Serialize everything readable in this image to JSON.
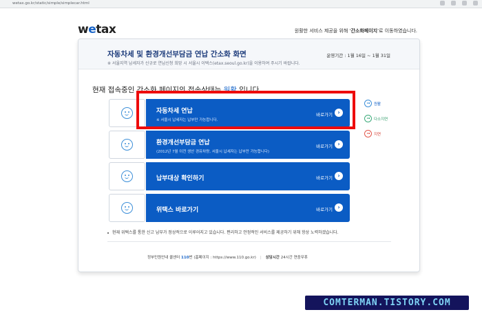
{
  "browser": {
    "url": "wetax.go.kr/static/simple/simplecar.html"
  },
  "header": {
    "logo_pre": "w",
    "logo_e": "e",
    "logo_post": "tax",
    "notice_pre": "원활한 서비스 제공을 위해 '",
    "notice_bold": "간소화페이지",
    "notice_post": "'로 이동하였습니다."
  },
  "card": {
    "title": "자동차세 및 환경개선부담금 연납 간소화 화면",
    "subtitle": "※ 서울지역 납세자가 신규로 연납신청 희망 시 서울시 이택스(etax.seoul.go.kr)을 이용하여 주시기 바랍니다.",
    "period": "운영기간 : 1월 16일 ~ 1월 31일",
    "status_pre": "현재 접속중인 간소화 페이지의 접속상태는 ",
    "status_value": "원활",
    "status_post": " 입니다."
  },
  "menu": [
    {
      "title": "자동차세 연납",
      "desc": "※ 서울시 납세자는 납부만 가능합니다.",
      "go": "바로가기"
    },
    {
      "title": "환경개선부담금 연납",
      "desc": "(2012년 7월 이전 생산 경유차량, 서울시 납세자는 납부만 가능합니다)",
      "go": "바로가기"
    },
    {
      "title": "납부대상 확인하기",
      "desc": "",
      "go": "바로가기"
    },
    {
      "title": "위택스 바로가기",
      "desc": "",
      "go": "바로가기"
    }
  ],
  "legend": {
    "smooth": "원활",
    "slow": "다소지연",
    "delay": "지연"
  },
  "bottom_notice": "현재 위택스를 통한 신고 납부가 정상적으로 이루어지고 있습니다. 편리하고 안정적인 서비스를 제공하기 위해 항상 노력하겠습니다.",
  "footer": {
    "call_pre": "정부민원안내 콜센터 ",
    "call_num": "110",
    "call_post": "번 (홈페이지 : https://www.110.go.kr)",
    "hours_label": "상담시간",
    "hours_value": " 24시간 연중무휴"
  },
  "watermark": "COMTERMAN.TISTORY.COM",
  "colors": {
    "primary": "#0b5cc4",
    "highlight": "#ee0b0b",
    "title": "#1b3a7a"
  }
}
